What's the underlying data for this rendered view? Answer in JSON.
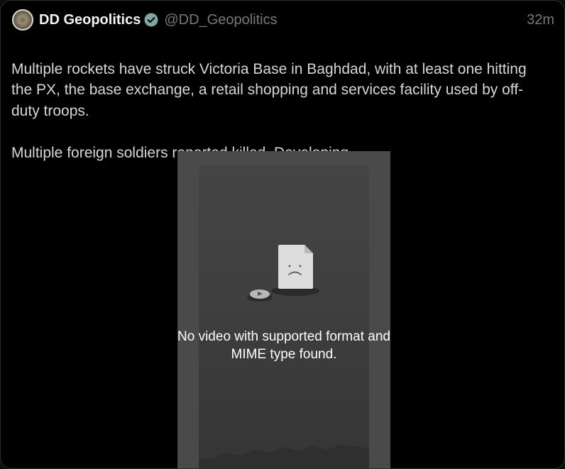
{
  "post": {
    "author_name": "DD Geopolitics",
    "handle": "@DD_Geopolitics",
    "timestamp": "32m",
    "verified": true,
    "flag_icon": "iraq-flag",
    "paragraphs": [
      "Multiple rockets have struck Victoria Base in Baghdad, with at least one hitting the PX, the base exchange, a retail shopping and services facility used by off-duty troops.",
      "Multiple foreign soldiers reported killed. Developing."
    ]
  },
  "media": {
    "error_message": "No video with supported format and MIME type found."
  },
  "colors": {
    "background": "#000000",
    "name": "#f2f4f3",
    "muted": "#767b7a",
    "verified_badge": "#7fa7a3",
    "media_bg": "#4a4a4a"
  }
}
